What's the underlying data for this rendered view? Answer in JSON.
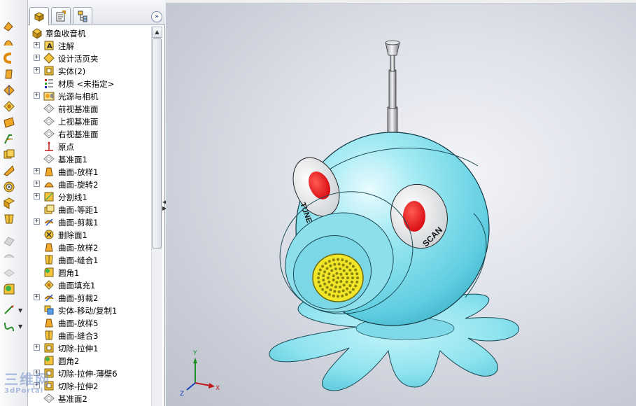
{
  "tree": {
    "root": "章鱼收音机",
    "items": [
      {
        "label": "注解",
        "icon": "annotations-icon",
        "expand": true
      },
      {
        "label": "设计活页夹",
        "icon": "design-binder-icon",
        "expand": true
      },
      {
        "label": "实体(2)",
        "icon": "solid-bodies-icon",
        "expand": true
      },
      {
        "label": "材质 <未指定>",
        "icon": "material-icon",
        "expand": false
      },
      {
        "label": "光源与相机",
        "icon": "lights-cameras-icon",
        "expand": true
      },
      {
        "label": "前视基准面",
        "icon": "plane-icon",
        "expand": false
      },
      {
        "label": "上视基准面",
        "icon": "plane-icon",
        "expand": false
      },
      {
        "label": "右视基准面",
        "icon": "plane-icon",
        "expand": false
      },
      {
        "label": "原点",
        "icon": "origin-icon",
        "expand": false
      },
      {
        "label": "基准面1",
        "icon": "plane-icon",
        "expand": false
      },
      {
        "label": "曲面-放样1",
        "icon": "surface-loft-icon",
        "expand": true
      },
      {
        "label": "曲面-旋转2",
        "icon": "surface-revolve-icon",
        "expand": true
      },
      {
        "label": "分割线1",
        "icon": "split-line-icon",
        "expand": true
      },
      {
        "label": "曲面-等距1",
        "icon": "surface-offset-icon",
        "expand": false
      },
      {
        "label": "曲面-剪裁1",
        "icon": "surface-trim-icon",
        "expand": true
      },
      {
        "label": "删除面1",
        "icon": "delete-face-icon",
        "expand": false
      },
      {
        "label": "曲面-放样2",
        "icon": "surface-loft-icon",
        "expand": false
      },
      {
        "label": "曲面-缝合1",
        "icon": "surface-knit-icon",
        "expand": false
      },
      {
        "label": "圆角1",
        "icon": "fillet-icon",
        "expand": false
      },
      {
        "label": "曲面填充1",
        "icon": "surface-fill-icon",
        "expand": false
      },
      {
        "label": "曲面-剪裁2",
        "icon": "surface-trim-icon",
        "expand": true
      },
      {
        "label": "实体-移动/复制1",
        "icon": "move-copy-icon",
        "expand": false
      },
      {
        "label": "曲面-放样5",
        "icon": "surface-loft-icon",
        "expand": false
      },
      {
        "label": "曲面-缝合3",
        "icon": "surface-knit-icon",
        "expand": false
      },
      {
        "label": "切除-拉伸1",
        "icon": "cut-extrude-icon",
        "expand": true
      },
      {
        "label": "圆角2",
        "icon": "fillet-icon",
        "expand": false
      },
      {
        "label": "切除-拉伸-薄壁6",
        "icon": "cut-extrude-icon",
        "expand": true
      },
      {
        "label": "切除-拉伸2",
        "icon": "cut-extrude-icon",
        "expand": true
      },
      {
        "label": "基准面2",
        "icon": "plane-icon",
        "expand": false
      }
    ]
  },
  "model": {
    "dial_label": "SCAN",
    "left_dial_label": "TUNE",
    "body_color": "#8fe4ef",
    "dial_red": "#e5141a",
    "speaker_yellow": "#f2e62a"
  },
  "triad": {
    "x": "X",
    "y": "Y",
    "z": "Z"
  },
  "watermark": {
    "main": "三维网",
    "sub": "3dPortal"
  }
}
